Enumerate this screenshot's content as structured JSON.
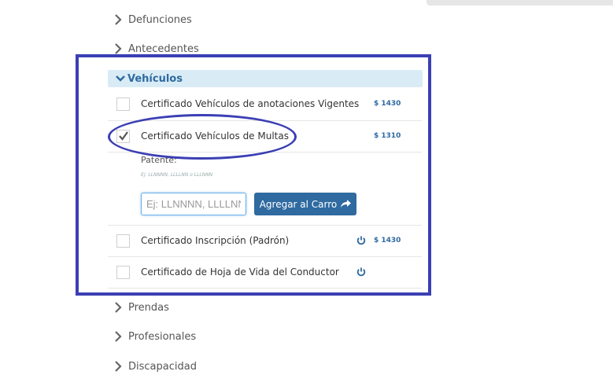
{
  "categories_top": [
    {
      "label": "Defunciones"
    },
    {
      "label": "Antecedentes"
    }
  ],
  "vehiculos": {
    "title": "Vehículos",
    "items": [
      {
        "label": "Certificado Vehículos de anotaciones Vigentes",
        "price": "$ 1430",
        "checked": false,
        "power_icon": false
      },
      {
        "label": "Certificado Vehículos de Multas",
        "price": "$ 1310",
        "checked": true,
        "power_icon": false
      },
      {
        "label": "Certificado Inscripción (Padrón)",
        "price": "$ 1430",
        "checked": false,
        "power_icon": true
      },
      {
        "label": "Certificado de Hoja de Vida del Conductor",
        "price": "",
        "checked": false,
        "power_icon": true
      }
    ],
    "patente": {
      "label": "Patente:",
      "hint": "Ej: LLNNNN, LLLLNN o LLLNNN",
      "placeholder": "Ej: LLNNNN, LLLLNN o LLLNNN",
      "value": ""
    },
    "add_button_label": "Agregar al Carro"
  },
  "categories_bottom": [
    {
      "label": "Prendas"
    },
    {
      "label": "Profesionales"
    },
    {
      "label": "Discapacidad"
    }
  ],
  "colors": {
    "accent": "#2f6aa0",
    "header_bg": "#d9ecf6",
    "annotation": "#3b3fb4"
  },
  "icons": {
    "collapsed": "chevron-right-icon",
    "expanded": "chevron-down-icon",
    "checked": "checkmark-icon",
    "power": "power-icon",
    "share": "share-arrow-icon"
  }
}
